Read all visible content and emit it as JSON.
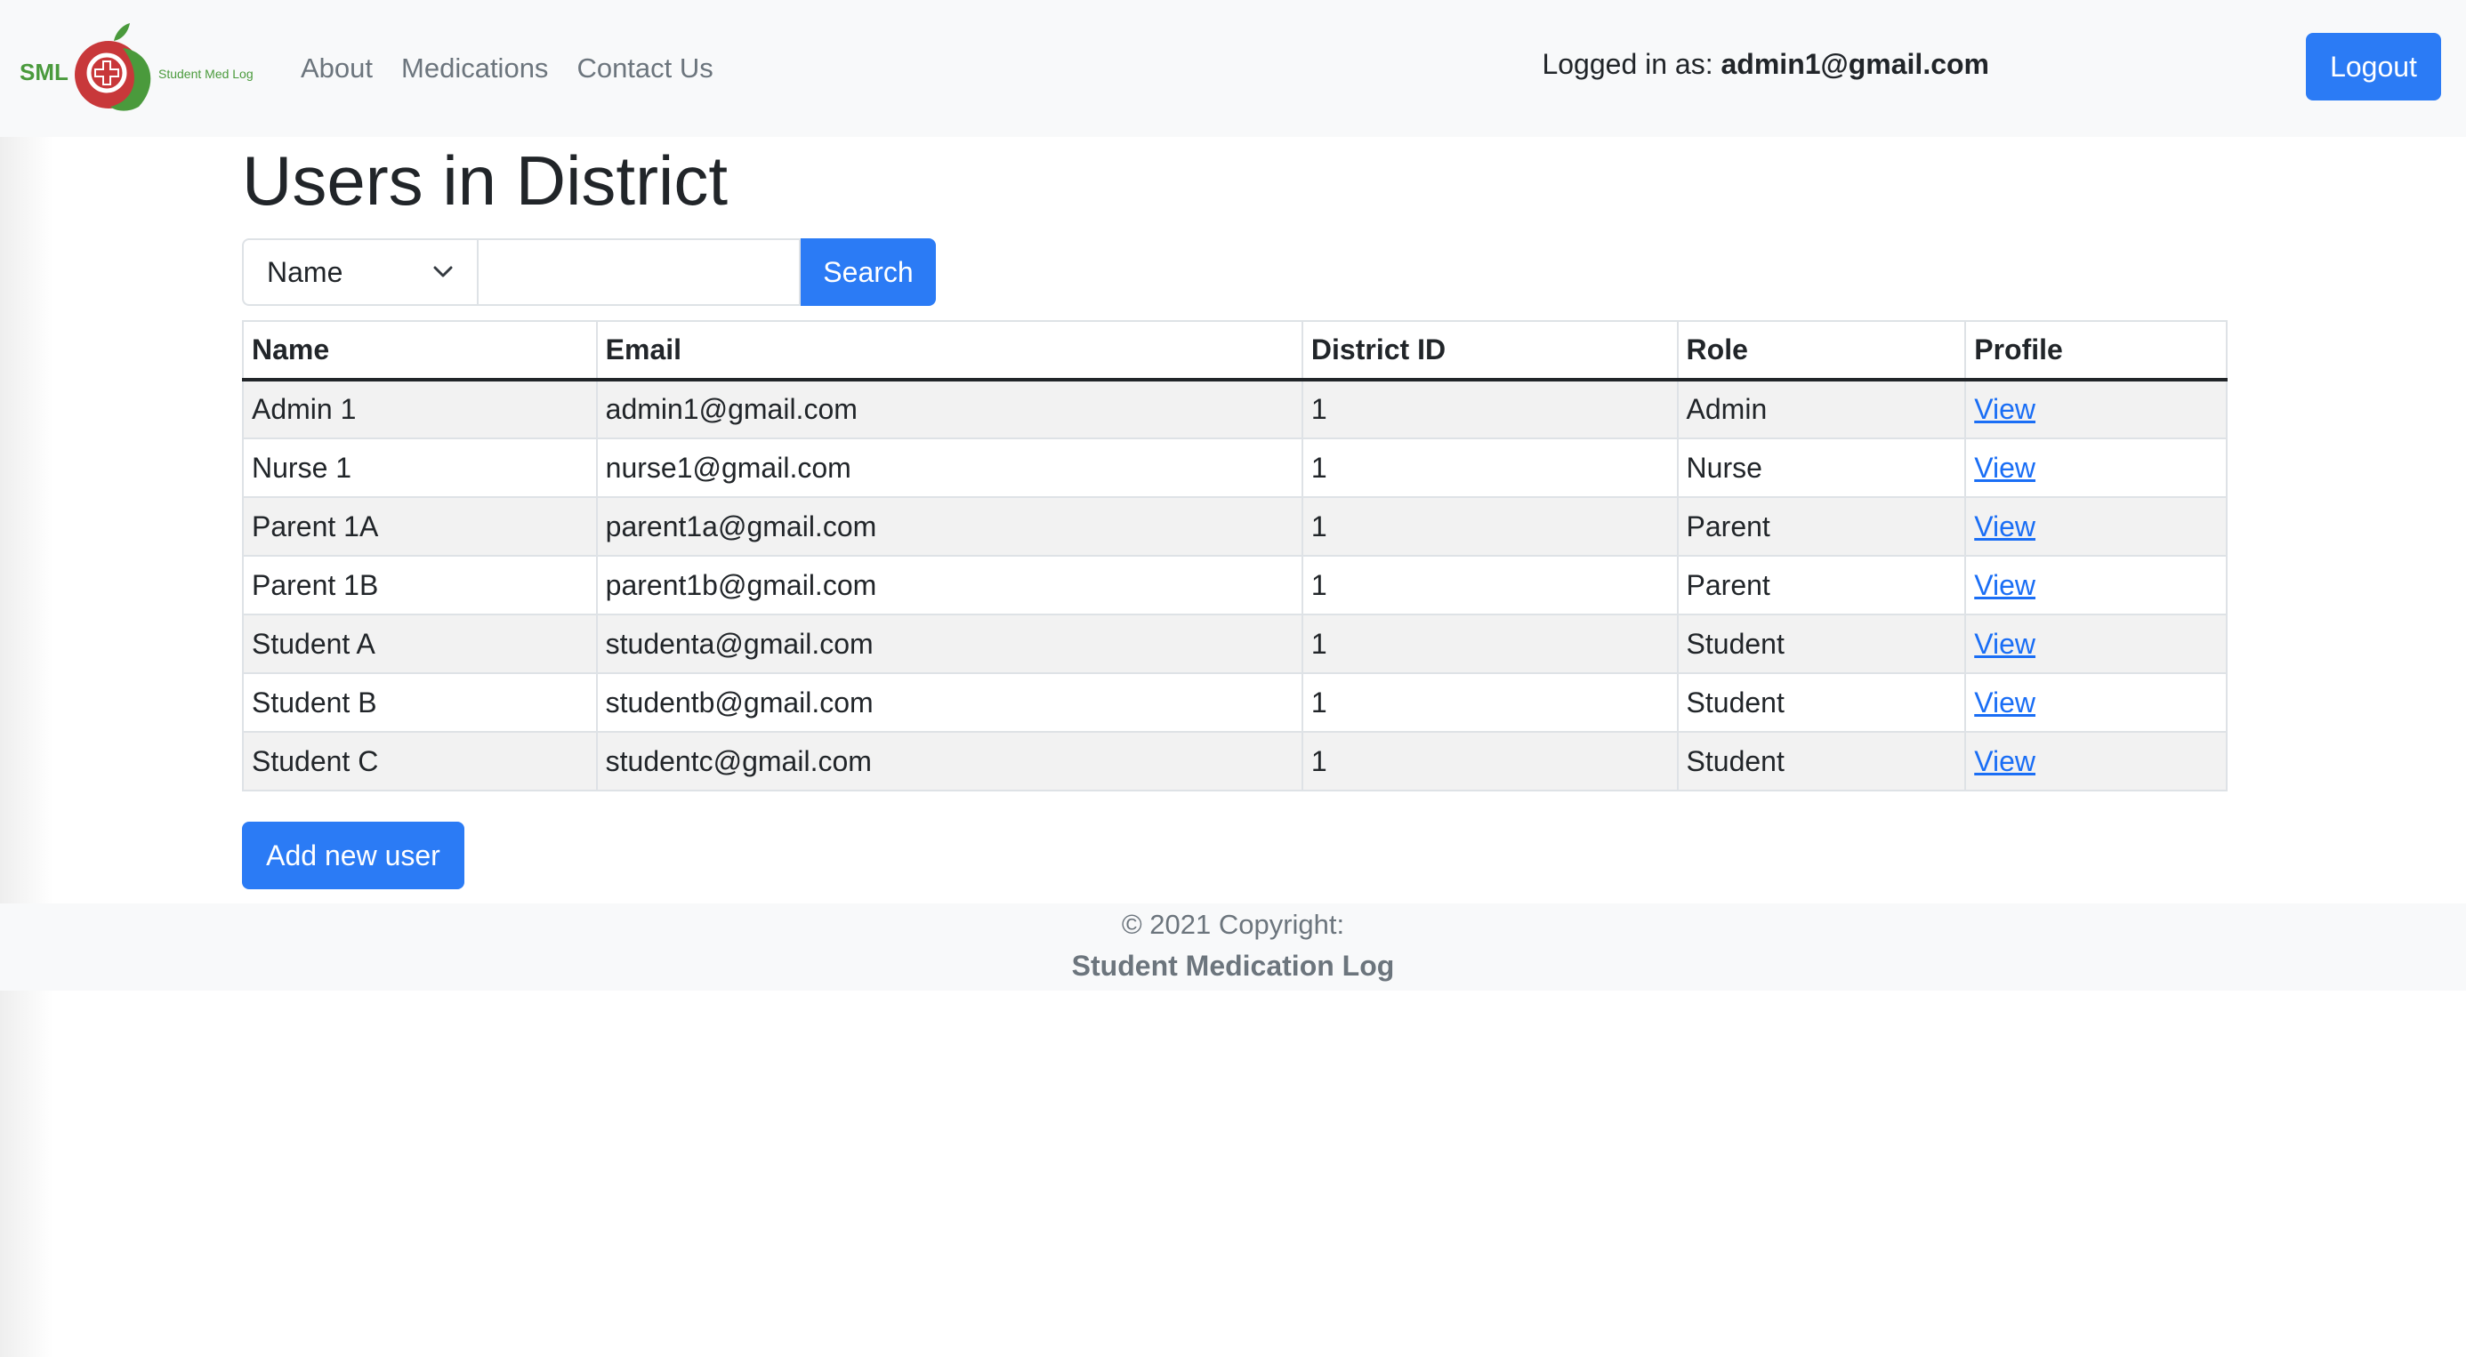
{
  "brand": {
    "abbr": "SML",
    "tagline": "Student Med Log",
    "colors": {
      "apple": "#c8383a",
      "leaf": "#4a9a3c"
    }
  },
  "nav": {
    "links": [
      "About",
      "Medications",
      "Contact Us"
    ],
    "logged_in_prefix": "Logged in as:",
    "logged_in_user": "admin1@gmail.com",
    "logout_label": "Logout"
  },
  "page": {
    "title": "Users in District"
  },
  "search": {
    "select_value": "Name",
    "input_value": "",
    "button_label": "Search"
  },
  "table": {
    "headers": [
      "Name",
      "Email",
      "District ID",
      "Role",
      "Profile"
    ],
    "rows": [
      [
        "Admin 1",
        "admin1@gmail.com",
        "1",
        "Admin",
        "View"
      ],
      [
        "Nurse 1",
        "nurse1@gmail.com",
        "1",
        "Nurse",
        "View"
      ],
      [
        "Parent 1A",
        "parent1a@gmail.com",
        "1",
        "Parent",
        "View"
      ],
      [
        "Parent 1B",
        "parent1b@gmail.com",
        "1",
        "Parent",
        "View"
      ],
      [
        "Student A",
        "studenta@gmail.com",
        "1",
        "Student",
        "View"
      ],
      [
        "Student B",
        "studentb@gmail.com",
        "1",
        "Student",
        "View"
      ],
      [
        "Student C",
        "studentc@gmail.com",
        "1",
        "Student",
        "View"
      ]
    ]
  },
  "actions": {
    "add_user_label": "Add new user"
  },
  "footer": {
    "copyright": "© 2021 Copyright:",
    "name": "Student Medication Log"
  },
  "colors": {
    "primary": "#2b7bf5",
    "link": "#1a6ef5",
    "navbar_bg": "#f8f9fa"
  }
}
